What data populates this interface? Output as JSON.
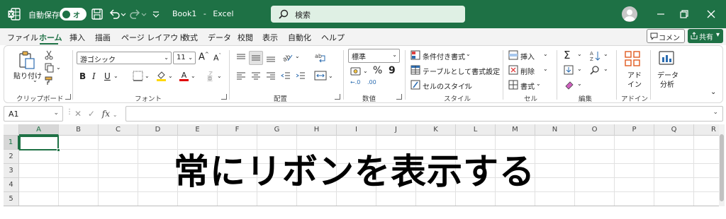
{
  "titlebar": {
    "autosave_label": "自動保存",
    "toggle_state": "オフ",
    "filename": "Book1",
    "separator": "-",
    "app_name": "Excel",
    "search_placeholder": "検索",
    "bg_color": "#1e7145"
  },
  "menu": {
    "items": [
      "ファイル",
      "ホーム",
      "挿入",
      "描画",
      "ページ レイアウト",
      "数式",
      "データ",
      "校閲",
      "表示",
      "自動化",
      "ヘルプ"
    ],
    "active": "ホーム",
    "comment_label": "コメント",
    "share_label": "共有"
  },
  "ribbon": {
    "clipboard": {
      "paste_label": "貼り付け",
      "group_label": "クリップボード"
    },
    "font": {
      "font_name": "游ゴシック",
      "font_size": "11",
      "bold": "B",
      "italic": "I",
      "underline": "U",
      "grow": "A",
      "shrink": "A",
      "group_label": "フォント"
    },
    "alignment": {
      "group_label": "配置"
    },
    "number": {
      "format": "標準",
      "percent": "%",
      "comma": "9",
      "inc": "←.0",
      "dec": ".00",
      "group_label": "数値"
    },
    "styles": {
      "conditional": "条件付き書式",
      "table": "テーブルとして書式設定",
      "cell_styles": "セルのスタイル",
      "group_label": "スタイル"
    },
    "cells": {
      "insert": "挿入",
      "delete": "削除",
      "format": "書式",
      "group_label": "セル"
    },
    "editing": {
      "sigma": "Σ",
      "group_label": "編集"
    },
    "addins": {
      "label_line1": "アド",
      "label_line2": "イン",
      "group_label": "アドイン"
    },
    "analysis": {
      "label_line1": "データ",
      "label_line2": "分析"
    }
  },
  "formula_bar": {
    "name_box": "A1",
    "fx": "fx"
  },
  "sheet": {
    "columns": [
      "A",
      "B",
      "C",
      "D",
      "E",
      "F",
      "G",
      "H",
      "I",
      "J",
      "K",
      "L",
      "M",
      "N",
      "O",
      "P",
      "Q",
      "R"
    ],
    "rows": [
      "1",
      "2",
      "3",
      "4",
      "5"
    ],
    "selected_cell": "A1"
  },
  "caption": "常にリボンを表示する"
}
